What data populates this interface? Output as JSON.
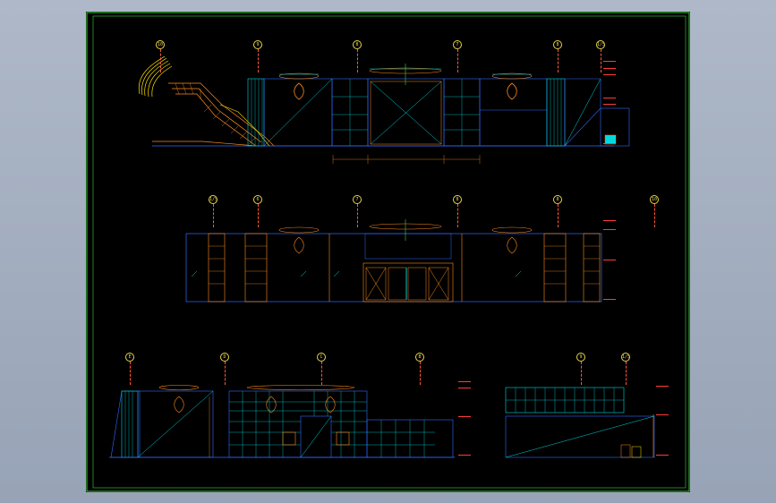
{
  "colors": {
    "background": "#a3aec0",
    "sheet": "#000000",
    "frame": "#3cd43c",
    "wall": "#2f6bff",
    "orange": "#ff8a1c",
    "cyan": "#00d8e0",
    "yellow": "#ffe200",
    "red": "#ff3b3b",
    "green": "#3cd43c"
  },
  "elevations": [
    {
      "id": "elev-1",
      "axis_labels": [
        "10",
        "9",
        "8",
        "7",
        "8",
        "1/5"
      ]
    },
    {
      "id": "elev-2",
      "axis_labels": [
        "1/5",
        "6",
        "7",
        "8",
        "8",
        "10"
      ]
    },
    {
      "id": "elev-3",
      "axis_labels": [
        "E",
        "D",
        "C",
        "B"
      ]
    },
    {
      "id": "elev-4",
      "axis_labels": [
        "9",
        "1/5"
      ]
    }
  ]
}
